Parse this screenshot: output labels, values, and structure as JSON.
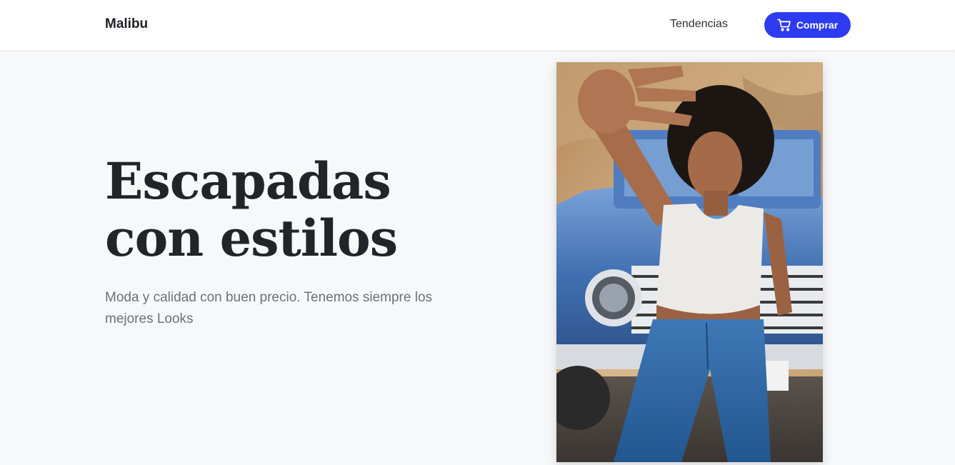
{
  "header": {
    "brand": "Malibu",
    "nav_link": "Tendencias",
    "buy_button_label": "Comprar",
    "buy_button_icon": "cart-icon"
  },
  "hero": {
    "title_line1": "Escapadas",
    "title_line2": "con estilos",
    "subtitle": "Moda y calidad con buen precio. Tenemos siempre los mejores Looks"
  },
  "colors": {
    "accent": "#2d3bf0",
    "background": "#f7f8fa",
    "title": "#212529",
    "subtitle": "#6b717a"
  }
}
